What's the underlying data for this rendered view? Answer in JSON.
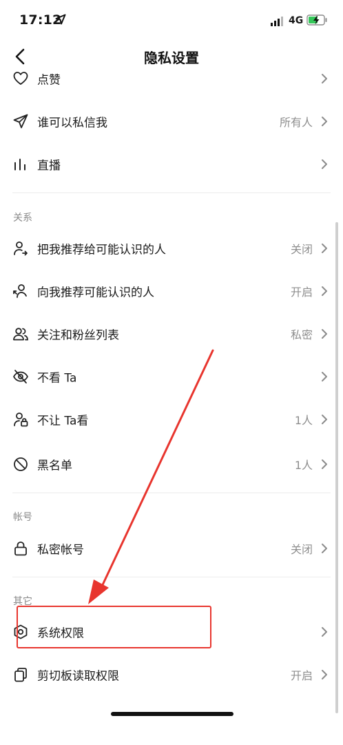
{
  "status": {
    "time": "17:12",
    "network": "4G"
  },
  "header": {
    "title": "隐私设置"
  },
  "rows": [
    {
      "label": "点赞",
      "value": ""
    },
    {
      "label": "谁可以私信我",
      "value": "所有人"
    },
    {
      "label": "直播",
      "value": ""
    }
  ],
  "sections": {
    "relations": {
      "title": "关系",
      "items": [
        {
          "label": "把我推荐给可能认识的人",
          "value": "关闭"
        },
        {
          "label": "向我推荐可能认识的人",
          "value": "开启"
        },
        {
          "label": "关注和粉丝列表",
          "value": "私密"
        },
        {
          "label": "不看 Ta",
          "value": ""
        },
        {
          "label": "不让 Ta看",
          "value": "1人"
        },
        {
          "label": "黑名单",
          "value": "1人"
        }
      ]
    },
    "account": {
      "title": "帐号",
      "items": [
        {
          "label": "私密帐号",
          "value": "关闭"
        }
      ]
    },
    "other": {
      "title": "其它",
      "items": [
        {
          "label": "系统权限",
          "value": ""
        },
        {
          "label": "剪切板读取权限",
          "value": "开启"
        }
      ]
    }
  },
  "colors": {
    "annotation": "#e8352e",
    "value_text": "#8e8e8e",
    "section_text": "#8a8a8a"
  },
  "icons": [
    "location-arrow-icon",
    "signal-icon",
    "battery-charging-icon",
    "back-chevron-icon",
    "heart-icon",
    "paper-plane-icon",
    "live-bars-icon",
    "person-share-icon",
    "person-recommend-icon",
    "people-icon",
    "eye-off-icon",
    "person-lock-icon",
    "block-icon",
    "lock-icon",
    "shield-gear-icon",
    "clipboard-icon",
    "chevron-right-icon"
  ]
}
